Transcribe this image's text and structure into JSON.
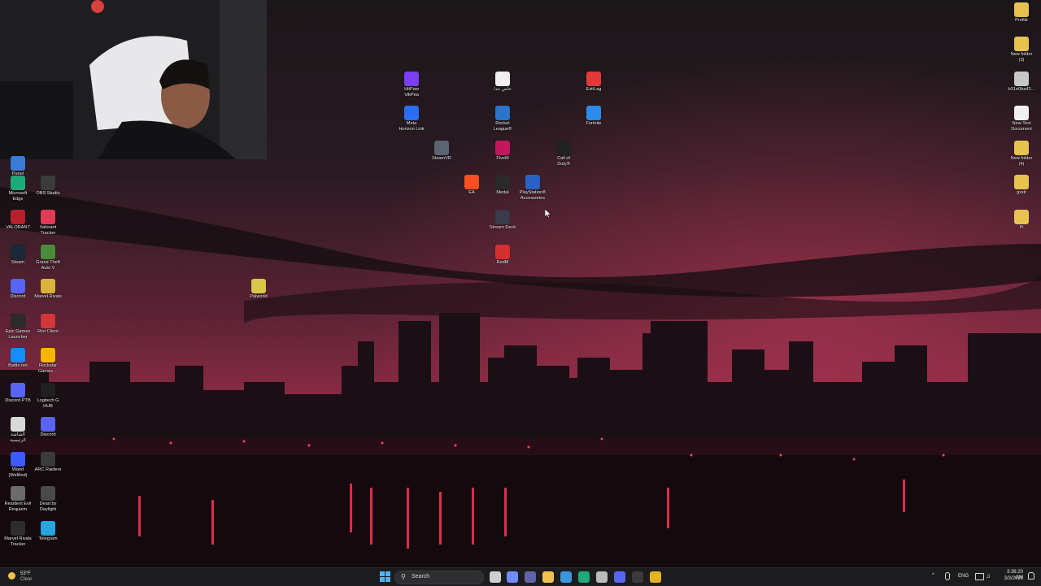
{
  "desktop": {
    "left_column": [
      {
        "label": "Panel",
        "icon": "control-panel-icon",
        "color": "#3a7bd5"
      },
      {
        "label": "Microsoft\nEdge",
        "icon": "edge-icon",
        "color": "#1fa87a"
      },
      {
        "label": "OBS Studio",
        "icon": "obs-icon",
        "color": "#3b3b3b"
      },
      {
        "label": "VALORANT",
        "icon": "valorant-icon",
        "color": "#b8202d"
      },
      {
        "label": "Valorant\nTracker",
        "icon": "valorant-tracker-icon",
        "color": "#e23b57"
      },
      {
        "label": "Steam",
        "icon": "steam-icon",
        "color": "#1b2838"
      },
      {
        "label": "Grand Theft\nAuto V",
        "icon": "gta-icon",
        "color": "#4b8b3b"
      },
      {
        "label": "Discord",
        "icon": "discord-icon",
        "color": "#5865f2"
      },
      {
        "label": "Marvel Rivals",
        "icon": "marvel-rivals-icon",
        "color": "#d8b53a"
      },
      {
        "label": "Epic Games\nLauncher",
        "icon": "epic-games-icon",
        "color": "#2b2b2b"
      },
      {
        "label": "Riot Client",
        "icon": "riot-client-icon",
        "color": "#d13639"
      },
      {
        "label": "Battle.net",
        "icon": "battlenet-icon",
        "color": "#148eff"
      },
      {
        "label": "Rockstar\nGames ...",
        "icon": "rockstar-icon",
        "color": "#f4b400"
      },
      {
        "label": "Discord PTB",
        "icon": "discord-ptb-icon",
        "color": "#5865f2"
      },
      {
        "label": "Logitech G\nHUB",
        "icon": "logitech-icon",
        "color": "#1f1f1f"
      },
      {
        "label": "ﺍﻟﺸﺎﺷﺔ\nﺍﻟﺮﺋﻴﺴﻴﺔ",
        "icon": "file-icon",
        "color": "#d9d9d9"
      },
      {
        "label": "Discord",
        "icon": "discord-icon",
        "color": "#5865f2"
      },
      {
        "label": "Wand\n(WeMod)",
        "icon": "wand-icon",
        "color": "#3d5afe"
      },
      {
        "label": "ARC Raiders",
        "icon": "arc-raiders-icon",
        "color": "#3a3a3a"
      },
      {
        "label": "Resident Evil\nRequiem",
        "icon": "resident-evil-icon",
        "color": "#6b6b6b"
      },
      {
        "label": "Dead by\nDaylight",
        "icon": "dead-by-daylight-icon",
        "color": "#4a4a4a"
      },
      {
        "label": "Marvel Rivals\nTracker",
        "icon": "marvel-rivals-tracker-icon",
        "color": "#2d2d2d"
      },
      {
        "label": "Telegram",
        "icon": "telegram-icon",
        "color": "#2aa3df"
      }
    ],
    "center": [
      {
        "label": "HitPaw\nVikPea",
        "icon": "hitpaw-icon",
        "color": "#7b3ff2"
      },
      {
        "label": "ﺧﺎﺹ ﺟﺪﺍ",
        "icon": "text-file-icon",
        "color": "#f0f0f0"
      },
      {
        "label": "ExitLag",
        "icon": "exitlag-icon",
        "color": "#e03a3a"
      },
      {
        "label": "Meta\nHorizon Link",
        "icon": "meta-icon",
        "color": "#2a6df4"
      },
      {
        "label": "Rocket\nLeague®",
        "icon": "rocket-league-icon",
        "color": "#2b74c9"
      },
      {
        "label": "Fortnite",
        "icon": "fortnite-icon",
        "color": "#2d8ceb"
      },
      {
        "label": "SteamVR",
        "icon": "steamvr-icon",
        "color": "#5b6470"
      },
      {
        "label": "FiveM",
        "icon": "fivem-icon",
        "color": "#c2185b"
      },
      {
        "label": "Call of\nDuty®",
        "icon": "call-of-duty-icon",
        "color": "#222222"
      },
      {
        "label": "EA",
        "icon": "ea-icon",
        "color": "#ff4e1f"
      },
      {
        "label": "Medal",
        "icon": "medal-icon",
        "color": "#2a2a2a"
      },
      {
        "label": "PlayStation®\nAccessories",
        "icon": "playstation-icon",
        "color": "#2b61c7"
      },
      {
        "label": "Stream Deck",
        "icon": "stream-deck-icon",
        "color": "#3a3a4a"
      },
      {
        "label": "RedM",
        "icon": "redm-icon",
        "color": "#d32f2f"
      },
      {
        "label": "Palworld",
        "icon": "palworld-icon",
        "color": "#d9c64a"
      }
    ],
    "right_column": [
      {
        "label": "Profile",
        "icon": "folder-icon",
        "color": "#e8c250"
      },
      {
        "label": "New folder\n(3)",
        "icon": "folder-icon",
        "color": "#e8c250"
      },
      {
        "label": "b31e0ba42...",
        "icon": "file-icon",
        "color": "#c7c7c7"
      },
      {
        "label": "New Text\nDocument",
        "icon": "text-file-icon",
        "color": "#f0f0f0"
      },
      {
        "label": "New folder\n(4)",
        "icon": "folder-icon",
        "color": "#e8c250"
      },
      {
        "label": "gxxlr",
        "icon": "folder-icon",
        "color": "#e8c250"
      },
      {
        "label": "Pi",
        "icon": "folder-icon",
        "color": "#e8c250"
      }
    ]
  },
  "taskbar": {
    "weather": {
      "temp": "53°F",
      "condition": "Clear"
    },
    "search_label": "Search",
    "apps": [
      {
        "name": "task-view-icon",
        "color": "#cfcfcf"
      },
      {
        "name": "copilot-icon",
        "color": "#6f8cff"
      },
      {
        "name": "teams-icon",
        "color": "#6264a7"
      },
      {
        "name": "file-explorer-icon",
        "color": "#f2c14e"
      },
      {
        "name": "store-icon",
        "color": "#3a96dd"
      },
      {
        "name": "edge-icon",
        "color": "#1fa87a"
      },
      {
        "name": "xbox-icon",
        "color": "#bbbbbb"
      },
      {
        "name": "discord-icon",
        "color": "#5865f2"
      },
      {
        "name": "snipping-icon",
        "color": "#3a3a3a"
      },
      {
        "name": "chrome-icon",
        "color": "#e0b521"
      }
    ],
    "tray": {
      "language": "ENG",
      "time": "3:36:20 AM",
      "date": "3/3/2026"
    }
  }
}
